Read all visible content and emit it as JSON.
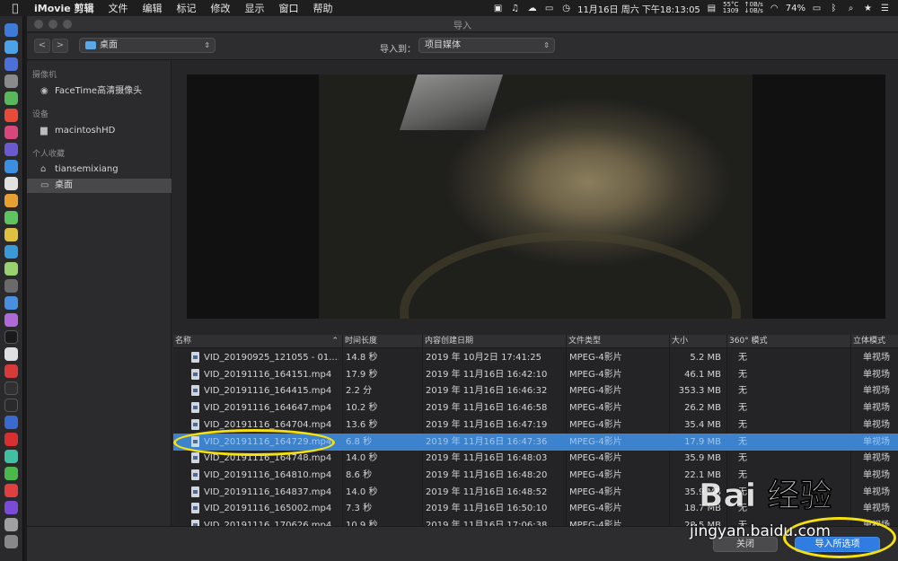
{
  "menubar": {
    "app_name": "iMovie 剪辑",
    "menus": [
      "文件",
      "编辑",
      "标记",
      "修改",
      "显示",
      "窗口",
      "帮助"
    ],
    "clock": "11月16日 周六 下午18:13:05",
    "temp": "55°C",
    "fan": "1309",
    "net_up": "↑0B/s",
    "net_down": "↓0B/s",
    "battery": "74%"
  },
  "window": {
    "title": "导入"
  },
  "toolbar": {
    "location": "桌面",
    "import_to_label": "导入到：",
    "import_to_value": "项目媒体"
  },
  "sidebar": {
    "sections": [
      {
        "label": "摄像机",
        "items": [
          {
            "label": "FaceTime高清摄像头",
            "icon": "camera-icon"
          }
        ]
      },
      {
        "label": "设备",
        "items": [
          {
            "label": "macintoshHD",
            "icon": "disk-icon"
          }
        ]
      },
      {
        "label": "个人收藏",
        "items": [
          {
            "label": "tiansemixiang",
            "icon": "home-icon"
          },
          {
            "label": "桌面",
            "icon": "desktop-icon",
            "selected": true
          }
        ]
      }
    ]
  },
  "table": {
    "columns": [
      "名称",
      "时间长度",
      "内容创建日期",
      "文件类型",
      "大小",
      "360° 模式",
      "立体模式"
    ],
    "rows": [
      [
        "VID_20190925_121055 - 01....",
        "14.8 秒",
        "2019 年 10月2日 17:41:25",
        "MPEG-4影片",
        "5.2 MB",
        "无",
        "单视场"
      ],
      [
        "VID_20191116_164151.mp4",
        "17.9 秒",
        "2019 年 11月16日 16:42:10",
        "MPEG-4影片",
        "46.1 MB",
        "无",
        "单视场"
      ],
      [
        "VID_20191116_164415.mp4",
        "2.2 分",
        "2019 年 11月16日 16:46:32",
        "MPEG-4影片",
        "353.3 MB",
        "无",
        "单视场"
      ],
      [
        "VID_20191116_164647.mp4",
        "10.2 秒",
        "2019 年 11月16日 16:46:58",
        "MPEG-4影片",
        "26.2 MB",
        "无",
        "单视场"
      ],
      [
        "VID_20191116_164704.mp4",
        "13.6 秒",
        "2019 年 11月16日 16:47:19",
        "MPEG-4影片",
        "35.4 MB",
        "无",
        "单视场"
      ],
      [
        "VID_20191116_164729.mp4",
        "6.8 秒",
        "2019 年 11月16日 16:47:36",
        "MPEG-4影片",
        "17.9 MB",
        "无",
        "单视场"
      ],
      [
        "VID_20191116_164748.mp4",
        "14.0 秒",
        "2019 年 11月16日 16:48:03",
        "MPEG-4影片",
        "35.9 MB",
        "无",
        "单视场"
      ],
      [
        "VID_20191116_164810.mp4",
        "8.6 秒",
        "2019 年 11月16日 16:48:20",
        "MPEG-4影片",
        "22.1 MB",
        "无",
        "单视场"
      ],
      [
        "VID_20191116_164837.mp4",
        "14.0 秒",
        "2019 年 11月16日 16:48:52",
        "MPEG-4影片",
        "35.9 MB",
        "无",
        "单视场"
      ],
      [
        "VID_20191116_165002.mp4",
        "7.3 秒",
        "2019 年 11月16日 16:50:10",
        "MPEG-4影片",
        "18.7 MB",
        "无",
        "单视场"
      ],
      [
        "VID_20191116_170626.mp4",
        "10.9 秒",
        "2019 年 11月16日 17:06:38",
        "MPEG-4影片",
        "28.5 MB",
        "无",
        "单视场"
      ]
    ],
    "selected_row": 5
  },
  "buttons": {
    "close": "关闭",
    "import_selected": "导入所选项"
  },
  "watermark": {
    "text": "jingyan.baidu.com",
    "logo": "Bai 经验"
  },
  "colors": {
    "selection": "#3d82cc",
    "primary_button": "#2f7de0",
    "annotation": "#f4e10f"
  }
}
